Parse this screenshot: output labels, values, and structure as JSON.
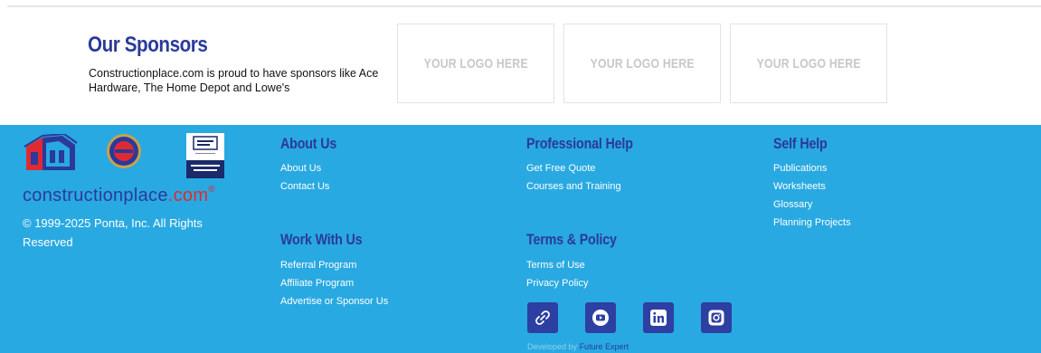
{
  "sponsors": {
    "title": "Our Sponsors",
    "description": "Constructionplace.com is proud to have sponsors like Ace Hardware, The Home Depot and Lowe's",
    "logo_placeholders": [
      "YOUR LOGO HERE",
      "YOUR LOGO HERE",
      "YOUR LOGO HERE"
    ]
  },
  "footer": {
    "brand": {
      "name": "constructionplace",
      "suffix": ".com",
      "mark": "®"
    },
    "copyright": "© 1999-2025 Ponta, Inc. All Rights Reserved",
    "about": {
      "title": "About Us",
      "links": [
        "About Us",
        "Contact Us"
      ]
    },
    "work": {
      "title": "Work With Us",
      "links": [
        "Referral Program",
        "Affiliate Program",
        "Advertise or Sponsor Us"
      ]
    },
    "professional": {
      "title": "Professional Help",
      "links": [
        "Get Free Quote",
        "Courses and Training"
      ]
    },
    "terms": {
      "title": "Terms & Policy",
      "links": [
        "Terms of Use",
        "Privacy Policy"
      ]
    },
    "selfhelp": {
      "title": "Self Help",
      "links": [
        "Publications",
        "Worksheets",
        "Glossary",
        "Planning Projects"
      ]
    },
    "socials": [
      "link-icon",
      "youtube-icon",
      "linkedin-icon",
      "instagram-icon"
    ],
    "developed_by_label": "Developed by",
    "developer": "Future Expert"
  },
  "colors": {
    "footer_bg": "#29a9e1",
    "heading_blue": "#2a3a9a",
    "brand_red": "#e02a32",
    "social_bg": "#2d3fa3"
  }
}
